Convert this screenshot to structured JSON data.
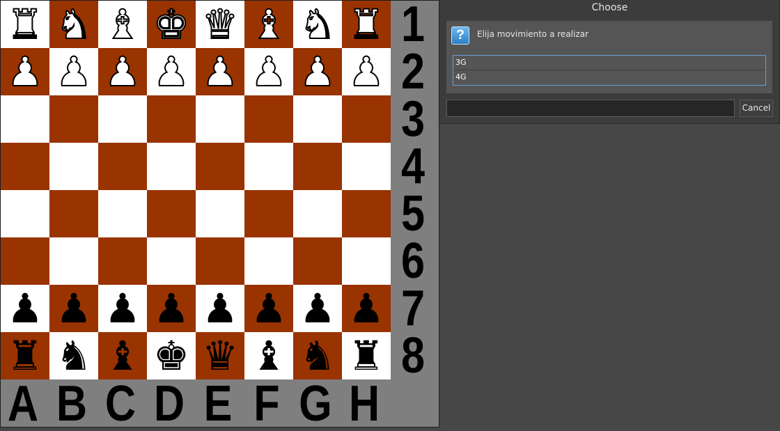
{
  "board": {
    "colors": {
      "light": "#ffffff",
      "dark": "#993300",
      "frame": "#7f7f7f"
    },
    "rank_labels": [
      "1",
      "2",
      "3",
      "4",
      "5",
      "6",
      "7",
      "8"
    ],
    "file_labels": [
      "A",
      "B",
      "C",
      "D",
      "E",
      "F",
      "G",
      "H"
    ],
    "ranks": [
      [
        "white-rook",
        "white-knight",
        "white-bishop",
        "white-king",
        "white-queen",
        "white-bishop",
        "white-knight",
        "white-rook"
      ],
      [
        "white-pawn",
        "white-pawn",
        "white-pawn",
        "white-pawn",
        "white-pawn",
        "white-pawn",
        "white-pawn",
        "white-pawn"
      ],
      [
        "",
        "",
        "",
        "",
        "",
        "",
        "",
        ""
      ],
      [
        "",
        "",
        "",
        "",
        "",
        "",
        "",
        ""
      ],
      [
        "",
        "",
        "",
        "",
        "",
        "",
        "",
        ""
      ],
      [
        "",
        "",
        "",
        "",
        "",
        "",
        "",
        ""
      ],
      [
        "black-pawn",
        "black-pawn",
        "black-pawn",
        "black-pawn",
        "black-pawn",
        "black-pawn",
        "black-pawn",
        "black-pawn"
      ],
      [
        "black-rook",
        "black-knight",
        "black-bishop",
        "black-king",
        "black-queen",
        "black-bishop",
        "black-knight",
        "black-rook"
      ]
    ]
  },
  "dialog": {
    "title": "Choose",
    "icon": "question-icon",
    "prompt": "Elija movimiento a realizar",
    "options": [
      "3G",
      "4G"
    ],
    "entry_value": "",
    "cancel_label": "Cancel"
  }
}
